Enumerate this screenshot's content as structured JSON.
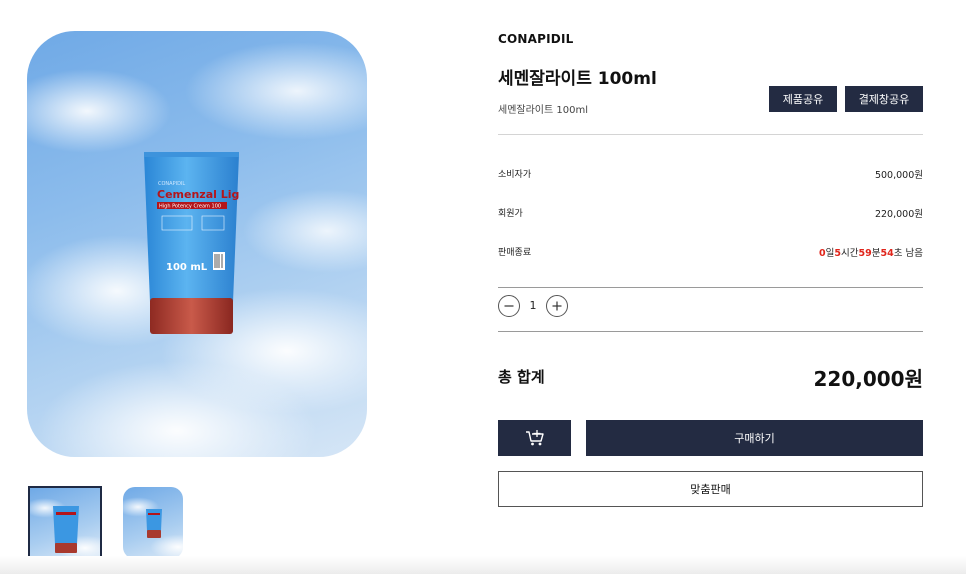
{
  "product": {
    "brand": "CONAPIDIL",
    "title": "세멘잘라이트 100ml",
    "subtitle": "세멘잘라이트 100ml",
    "image_alt": "Cemenzal Light tube",
    "tube_label": {
      "brand_small": "CONAPIDIL",
      "name": "Cemenzal Light",
      "sub": "High Potency Cream 100",
      "size": "100 mL"
    }
  },
  "actions": {
    "share_product": "제품공유",
    "share_checkout": "결제창공유",
    "buy": "구매하기",
    "custom_sale": "맞춤판매",
    "cart_icon": "cart-add-icon"
  },
  "pricing": {
    "consumer_label": "소비자가",
    "consumer_price": "500,000원",
    "member_label": "회원가",
    "member_price": "220,000원",
    "sale_end_label": "판매종료",
    "countdown": {
      "days": "0",
      "days_unit": "일",
      "hours": "5",
      "hours_unit": "시간",
      "minutes": "59",
      "minutes_unit": "분",
      "seconds": "54",
      "seconds_unit": "초 남음"
    }
  },
  "quantity": {
    "value": "1"
  },
  "total": {
    "label": "총 합계",
    "value": "220,000원"
  },
  "colors": {
    "accent": "#232b42",
    "countdown_red": "#e0251b"
  }
}
